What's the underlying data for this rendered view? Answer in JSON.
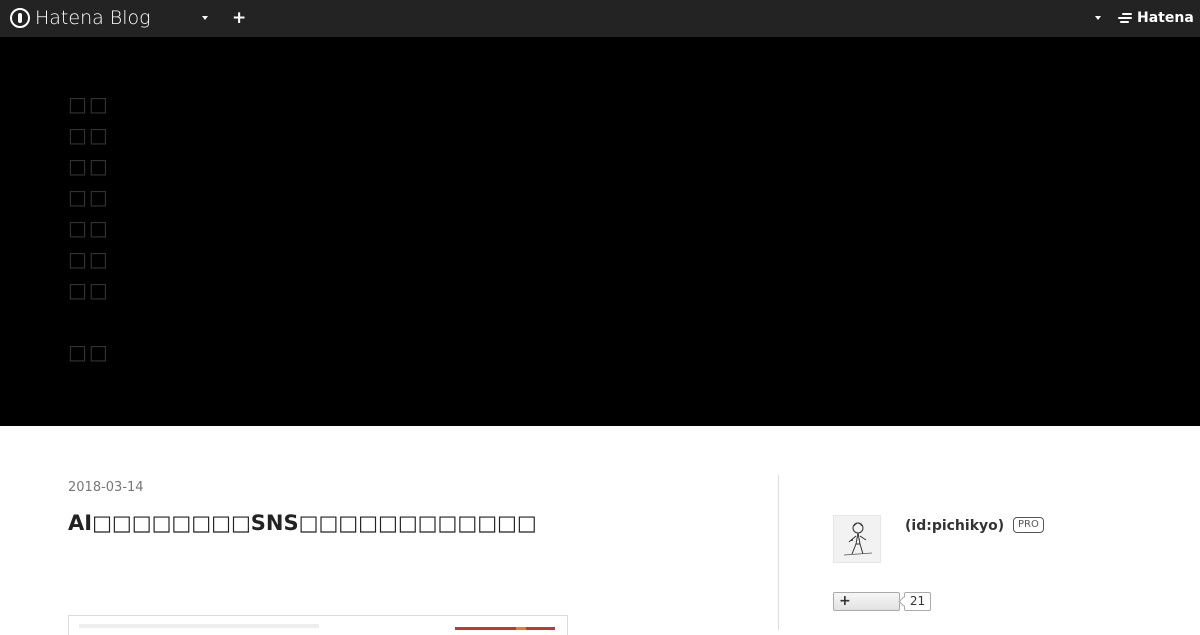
{
  "globalnav": {
    "logo_text": "Hatena Blog",
    "add_label": "+",
    "hatena_label": "Hatena"
  },
  "blog": {
    "title_glyphs": [
      "□□",
      "□□",
      "□□",
      "□□",
      "□□",
      "□□",
      "□□",
      "",
      "□□"
    ]
  },
  "entry": {
    "date": "2018-03-14",
    "title": "AI□□□□□□□□SNS□□□□□□□□□□□□"
  },
  "sidebar": {
    "author_id": "(id:pichikyo)",
    "pro_badge": "PRO",
    "follow_icon": "+",
    "follower_count": "21"
  },
  "colors": {
    "nav_background": "#232323",
    "header_background": "#000000",
    "accent_red": "#c0392b"
  }
}
